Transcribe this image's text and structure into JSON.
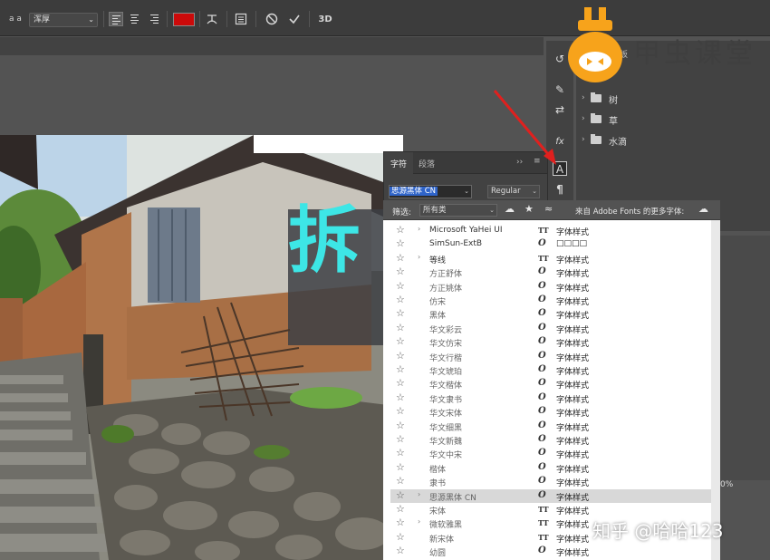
{
  "options_bar": {
    "font_size_glyph": "a a",
    "font_family": "浑厚",
    "text_color": "#cc0a0a",
    "label_3d": "3D"
  },
  "canvas": {
    "big_text": "拆",
    "big_text_color": "#3de6e6"
  },
  "tool_strip": {
    "character_icon_glyph": "A",
    "paragraph_icon_glyph": "¶",
    "fx_label": "fx"
  },
  "layers": {
    "partial_label": "板",
    "groups": [
      {
        "name": "树"
      },
      {
        "name": "草"
      },
      {
        "name": "水滴"
      }
    ]
  },
  "character_panel": {
    "tabs": [
      "字符",
      "段落"
    ],
    "font_field": "思源黑体 CN",
    "style_field": "Regular"
  },
  "font_list": {
    "filter_label": "筛选:",
    "filter_value": "所有类",
    "adobe_fonts_text": "来自 Adobe Fonts 的更多字体:",
    "sample_text": "字体样式",
    "rows": [
      {
        "name": "Microsoft YaHei UI",
        "type": "TT",
        "expand": true,
        "sample": "字体样式",
        "selected": false
      },
      {
        "name": "SimSun-ExtB",
        "type": "O",
        "expand": false,
        "sample": "□□□□",
        "selected": false
      },
      {
        "name": "等线",
        "type": "TT",
        "expand": true,
        "sample": "字体样式",
        "selected": false
      },
      {
        "name": "方正舒体",
        "type": "O",
        "expand": false,
        "sample": "字体样式",
        "selected": false
      },
      {
        "name": "方正姚体",
        "type": "O",
        "expand": false,
        "sample": "字体样式",
        "selected": false
      },
      {
        "name": "仿宋",
        "type": "O",
        "expand": false,
        "sample": "字体样式",
        "selected": false
      },
      {
        "name": "黑体",
        "type": "O",
        "expand": false,
        "sample": "字体样式",
        "selected": false
      },
      {
        "name": "华文彩云",
        "type": "O",
        "expand": false,
        "sample": "字体样式",
        "selected": false
      },
      {
        "name": "华文仿宋",
        "type": "O",
        "expand": false,
        "sample": "字体样式",
        "selected": false
      },
      {
        "name": "华文行楷",
        "type": "O",
        "expand": false,
        "sample": "字体样式",
        "selected": false
      },
      {
        "name": "华文琥珀",
        "type": "O",
        "expand": false,
        "sample": "字体样式",
        "selected": false
      },
      {
        "name": "华文楷体",
        "type": "O",
        "expand": false,
        "sample": "字体样式",
        "selected": false
      },
      {
        "name": "华文隶书",
        "type": "O",
        "expand": false,
        "sample": "字体样式",
        "selected": false
      },
      {
        "name": "华文宋体",
        "type": "O",
        "expand": false,
        "sample": "字体样式",
        "selected": false
      },
      {
        "name": "华文细黑",
        "type": "O",
        "expand": false,
        "sample": "字体样式",
        "selected": false
      },
      {
        "name": "华文新魏",
        "type": "O",
        "expand": false,
        "sample": "字体样式",
        "selected": false
      },
      {
        "name": "华文中宋",
        "type": "O",
        "expand": false,
        "sample": "字体样式",
        "selected": false
      },
      {
        "name": "楷体",
        "type": "O",
        "expand": false,
        "sample": "字体样式",
        "selected": false
      },
      {
        "name": "隶书",
        "type": "O",
        "expand": false,
        "sample": "字体样式",
        "selected": false
      },
      {
        "name": "思源黑体 CN",
        "type": "O",
        "expand": true,
        "sample": "字体样式",
        "selected": true
      },
      {
        "name": "宋体",
        "type": "TT",
        "expand": false,
        "sample": "字体样式",
        "selected": false
      },
      {
        "name": "微软雅黑",
        "type": "TT",
        "expand": true,
        "sample": "字体样式",
        "selected": false
      },
      {
        "name": "新宋体",
        "type": "TT",
        "expand": false,
        "sample": "字体样式",
        "selected": false
      },
      {
        "name": "幼圆",
        "type": "O",
        "expand": false,
        "sample": "字体样式",
        "selected": false
      }
    ]
  },
  "zoom_partial": "0%",
  "watermarks": {
    "brand": "甲虫课堂",
    "zhihu": "知乎 @哈哈123"
  }
}
